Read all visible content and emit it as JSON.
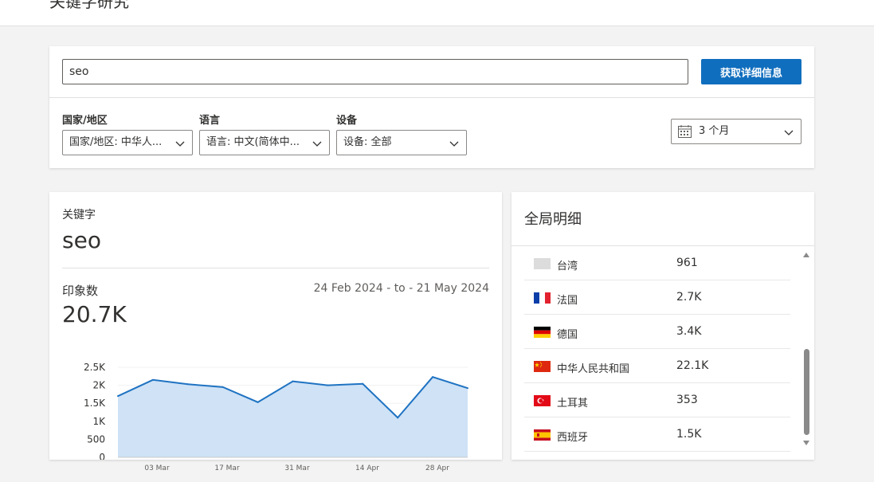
{
  "page": {
    "title": "关键字研究"
  },
  "search": {
    "value": "seo",
    "button_label": "获取详细信息"
  },
  "filters": [
    {
      "label": "国家/地区",
      "value": "国家/地区: 中华人..."
    },
    {
      "label": "语言",
      "value": "语言: 中文(简体中..."
    },
    {
      "label": "设备",
      "value": "设备: 全部"
    }
  ],
  "date_filter": {
    "value": "3 个月"
  },
  "keyword_panel": {
    "label": "关键字",
    "keyword": "seo",
    "impressions_label": "印象数",
    "impressions_value": "20.7K",
    "date_range": "24 Feb 2024 - to - 21 May 2024"
  },
  "chart_data": {
    "type": "area",
    "x_tick_labels": [
      "03 Mar",
      "17 Mar",
      "31 Mar",
      "14 Apr",
      "28 Apr"
    ],
    "y_tick_labels": [
      "0",
      "500",
      "1K",
      "1.5K",
      "2K",
      "2.5K"
    ],
    "ylim": [
      0,
      2500
    ],
    "values": [
      1700,
      2150,
      2030,
      1950,
      1530,
      2110,
      2000,
      2040,
      1100,
      2230,
      1920
    ],
    "line_color": "#1f73c2",
    "fill_color": "#cfe2f6"
  },
  "details": {
    "title": "全局明细",
    "rows": [
      {
        "country": "台湾",
        "value": "961",
        "flag": "taiwan-flag"
      },
      {
        "country": "法国",
        "value": "2.7K",
        "flag": "france-flag"
      },
      {
        "country": "德国",
        "value": "3.4K",
        "flag": "germany-flag"
      },
      {
        "country": "中华人民共和国",
        "value": "22.1K",
        "flag": "china-flag"
      },
      {
        "country": "土耳其",
        "value": "353",
        "flag": "turkey-flag"
      },
      {
        "country": "西班牙",
        "value": "1.5K",
        "flag": "spain-flag"
      }
    ]
  }
}
